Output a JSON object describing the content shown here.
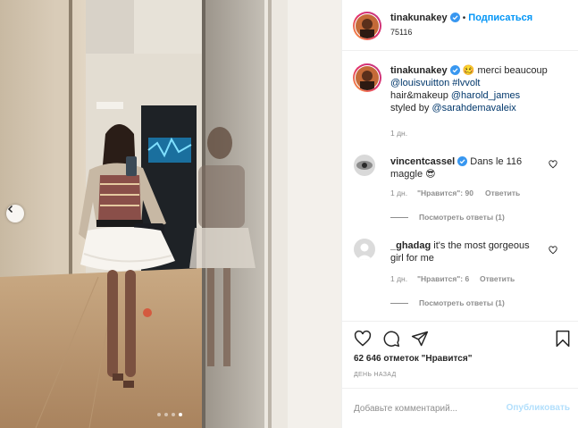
{
  "post": {
    "author": "tinakunakey",
    "follow_label": "Подписаться",
    "location": "75116",
    "carousel": {
      "total": 4,
      "current": 4
    }
  },
  "caption": {
    "author": "tinakunakey",
    "emoji": "🥴",
    "text": "merci beaucoup",
    "mention1": "@louisvuitton",
    "hashtag": "#lvvolt",
    "line3": "hair&makeup",
    "mention2": "@harold_james",
    "line4": "styled by",
    "mention3": "@sarahdemavaleix",
    "time": "1 дн."
  },
  "comments": [
    {
      "author": "vincentcassel",
      "text_line1": "Dans le 116",
      "text_line2": "maggle",
      "emoji": "😎",
      "time": "1 дн.",
      "likes": "\"Нравится\": 90",
      "reply": "Ответить",
      "view_replies": "Посмотреть ответы (1)"
    },
    {
      "author": "_ghadag",
      "text_line1": "it's the most gorgeous",
      "text_line2": "girl for me",
      "time": "1 дн.",
      "likes": "\"Нравится\": 6",
      "reply": "Ответить",
      "view_replies": "Посмотреть ответы (1)"
    }
  ],
  "likes_summary": "62 646 отметок \"Нравится\"",
  "time_ago": "ДЕНЬ НАЗАД",
  "comment_input": {
    "placeholder": "Добавьте комментарий...",
    "value": ""
  },
  "publish_label": "Опубликовать",
  "colors": {
    "link_blue": "#0095f6",
    "mention": "#00376b",
    "muted": "#8e8e8e",
    "verified": "#3897f0"
  },
  "icons": [
    "heart-icon",
    "comment-icon",
    "share-icon",
    "bookmark-icon",
    "verified-icon",
    "emoji-icon",
    "chevron-left-icon"
  ]
}
